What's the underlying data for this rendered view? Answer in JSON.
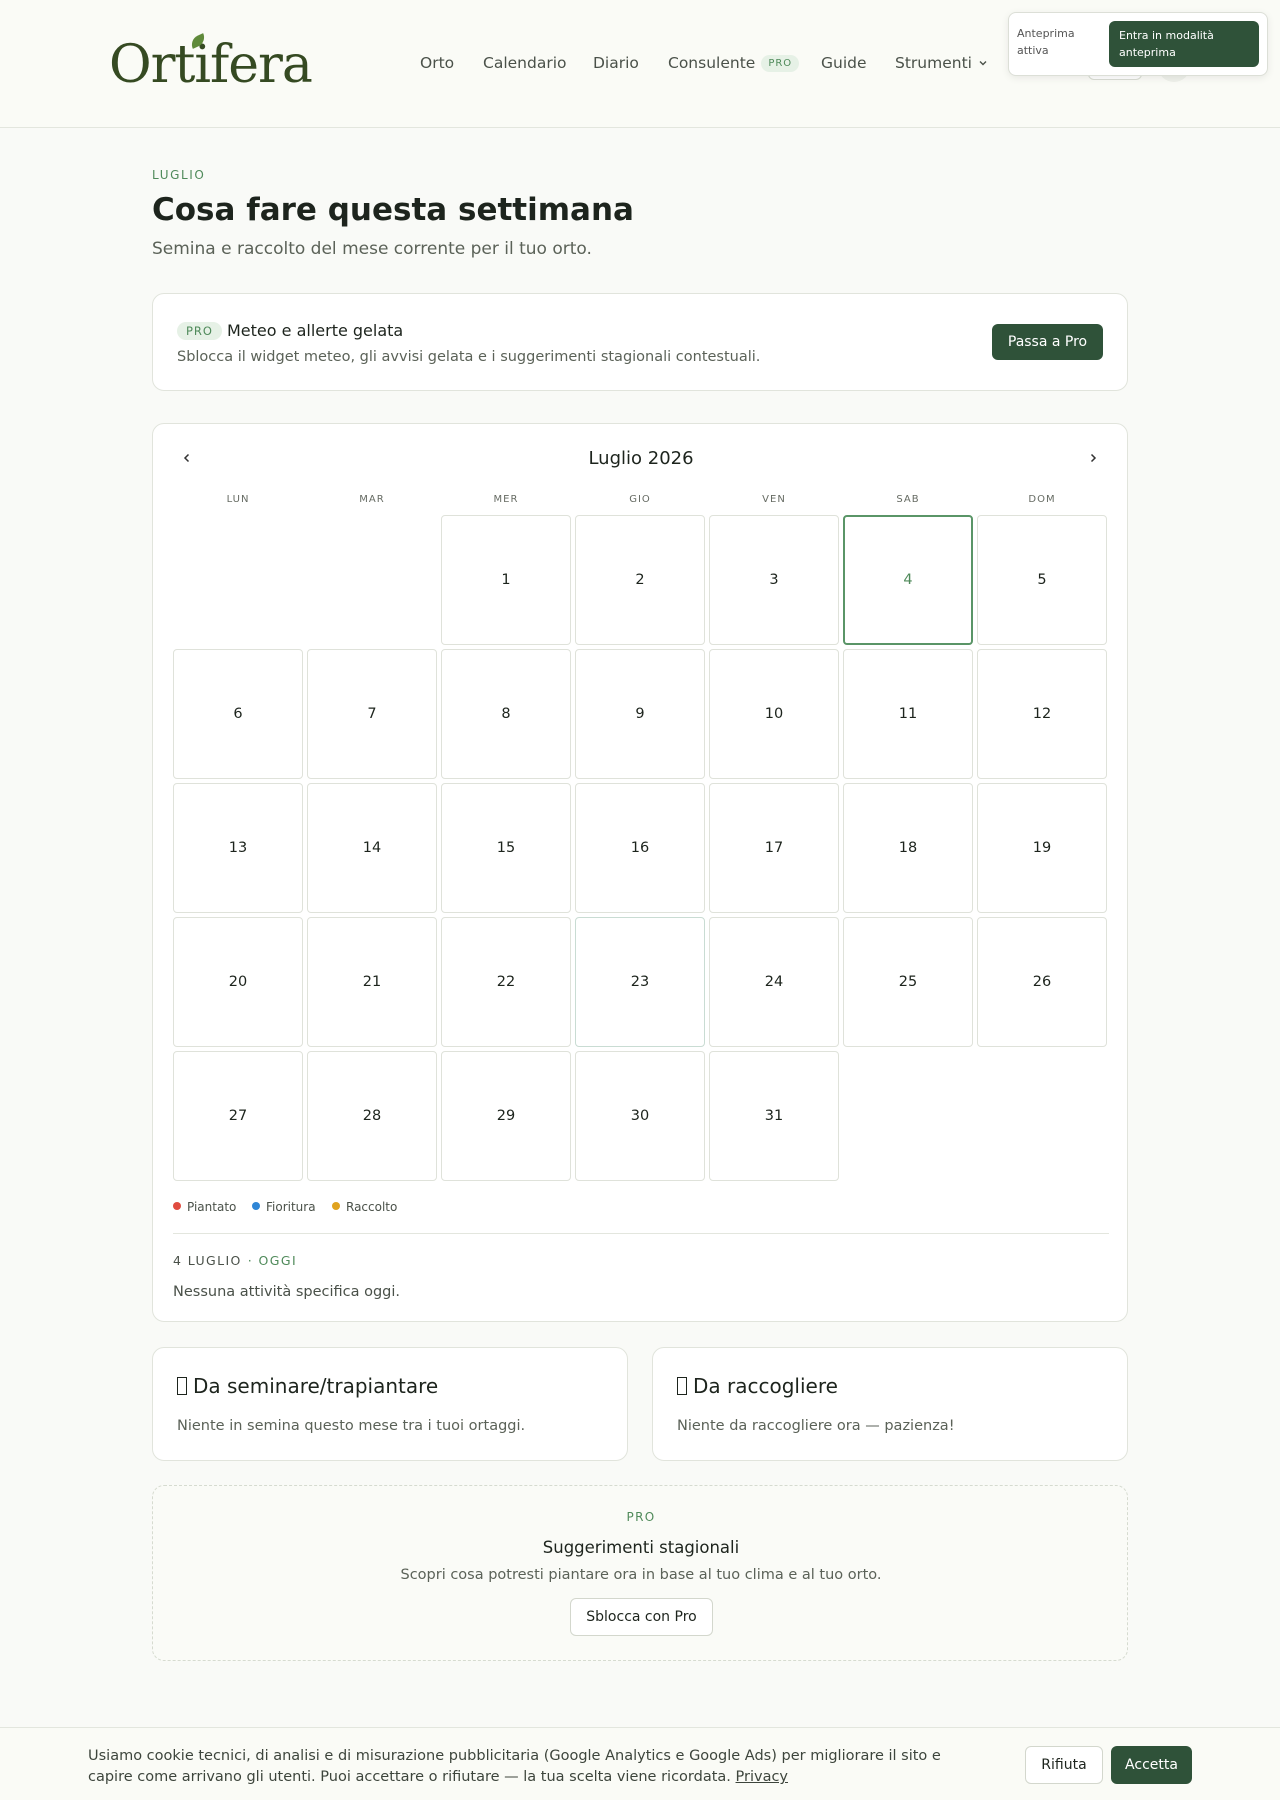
{
  "brand": {
    "logo_text": "Ortifera"
  },
  "nav": {
    "items": [
      {
        "label": "Orto"
      },
      {
        "label": "Calendario"
      },
      {
        "label": "Diario"
      },
      {
        "label": "Consulente",
        "badge": "PRO"
      },
      {
        "label": "Guide"
      },
      {
        "label": "Strumenti",
        "icon": "chevron-down-icon"
      }
    ]
  },
  "preview": {
    "status": "Anteprima attiva",
    "button_label": "Entra in modalità anteprima"
  },
  "page": {
    "eyebrow": "LUGLIO",
    "title": "Cosa fare questa settimana",
    "subtitle": "Semina e raccolto del mese corrente per il tuo orto."
  },
  "pro_weather": {
    "badge": "PRO",
    "title": "Meteo e allerte gelata",
    "description": "Sblocca il widget meteo, gli avvisi gelata e i suggerimenti stagionali contestuali.",
    "button_label": "Passa a Pro"
  },
  "calendar": {
    "title": "Luglio 2026",
    "prev_icon": "chevron-left-icon",
    "next_icon": "chevron-right-icon",
    "weekdays": [
      "LUN",
      "MAR",
      "MER",
      "GIO",
      "VEN",
      "SAB",
      "DOM"
    ],
    "days": [
      "1",
      "2",
      "3",
      "4",
      "5",
      "6",
      "7",
      "8",
      "9",
      "10",
      "11",
      "12",
      "13",
      "14",
      "15",
      "16",
      "17",
      "18",
      "19",
      "20",
      "21",
      "22",
      "23",
      "24",
      "25",
      "26",
      "27",
      "28",
      "29",
      "30",
      "31"
    ],
    "today": "4",
    "legend": [
      {
        "label": "Piantato",
        "color": "#e04b3f"
      },
      {
        "label": "Fioritura",
        "color": "#2f86d6"
      },
      {
        "label": "Raccolto",
        "color": "#e0a31f"
      }
    ],
    "selected_date": "4 LUGLIO",
    "selected_tag": "· OGGI",
    "selected_empty": "Nessuna attività specifica oggi."
  },
  "sow": {
    "title": "Da seminare/trapiantare",
    "text": "Niente in semina questo mese tra i tuoi ortaggi."
  },
  "harvest": {
    "title": "Da raccogliere",
    "text": "Niente da raccogliere ora — pazienza!"
  },
  "tips": {
    "eyebrow": "PRO",
    "title": "Suggerimenti stagionali",
    "description": "Scopri cosa potresti piantare ora in base al tuo clima e al tuo orto.",
    "button_label": "Sblocca con Pro"
  },
  "cookie": {
    "text": "Usiamo cookie tecnici, di analisi e di misurazione pubblicitaria (Google Analytics e Google Ads) per migliorare il sito e capire come arrivano gli utenti. Puoi accettare o rifiutare — la tua scelta viene ricordata.",
    "link_label": "Privacy",
    "reject_label": "Rifiuta",
    "accept_label": "Accetta"
  },
  "colors": {
    "accent": "#2f5239",
    "accent_light": "#4f8a5a",
    "background": "#f9faf7"
  }
}
